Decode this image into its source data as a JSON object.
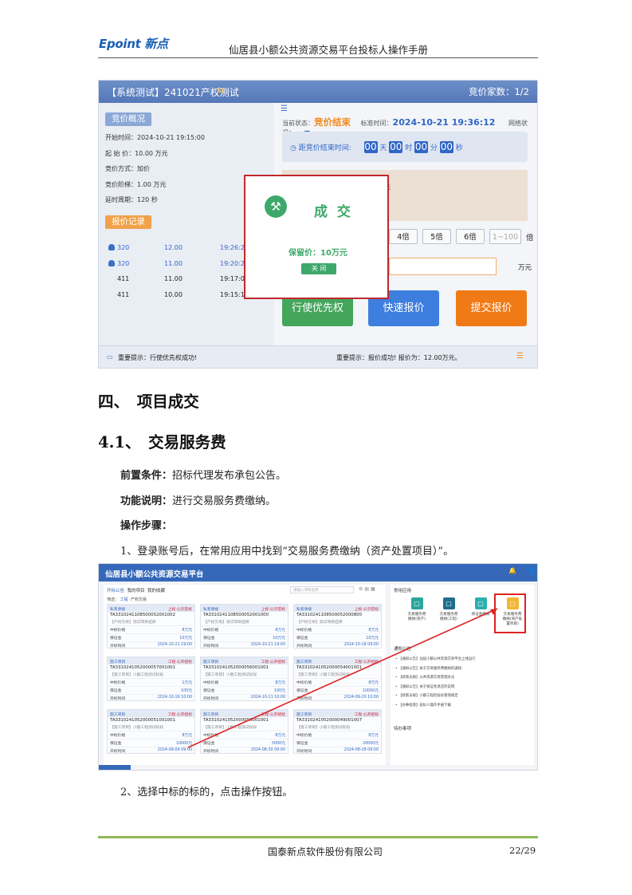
{
  "header": {
    "logo": "Epoint 新点",
    "doc_title": "仙居县小额公共资源交易平台投标人操作手册"
  },
  "shot1": {
    "title": "【系统测试】241021产权测试",
    "swap_icon": "⇆",
    "bidder_count_label": "竞价家数：1/2",
    "overview_tag": "竞价概况",
    "overview": [
      {
        "k": "开始时间：",
        "v": "2024-10-21 19:15:00"
      },
      {
        "k": "起 始 价：",
        "v": "10.00 万元"
      },
      {
        "k": "竞价方式：",
        "v": "加价"
      },
      {
        "k": "竞价阶梯：",
        "v": "1.00 万元"
      },
      {
        "k": "延时周期：",
        "v": "120 秒"
      }
    ],
    "records_tag": "报价记录",
    "records": [
      {
        "user": true,
        "id": "320",
        "price": "12.00",
        "time": "19:26:29"
      },
      {
        "user": true,
        "id": "320",
        "price": "11.00",
        "time": "19:20:22"
      },
      {
        "user": false,
        "id": "411",
        "price": "11.00",
        "time": "19:17:05"
      },
      {
        "user": false,
        "id": "411",
        "price": "10.00",
        "time": "19:15:13"
      }
    ],
    "status_label": "当前状态：",
    "status_value": "竞价结束",
    "std_time_label": "标准时间：",
    "std_time_value": "2024-10-21 19:36:12",
    "network_label": "网络状况：",
    "countdown_label": "距竞价结束时间:",
    "countdown": {
      "d": "00",
      "d_unit": "天",
      "h": "00",
      "h_unit": "时",
      "m": "00",
      "m_unit": "分",
      "s": "00",
      "s_unit": "秒"
    },
    "beige_fragment": "元",
    "multipliers": [
      "4倍",
      "5倍",
      "6倍",
      "1~100"
    ],
    "mult_unit": "倍",
    "amount_unit": "万元",
    "buttons": {
      "priority": "行使优先权",
      "quick": "快速报价",
      "submit": "提交报价"
    },
    "tip_left": "重要提示：行使优先权成功!",
    "tip_right": "重要提示：报价成功! 报价为：12.00万元。",
    "popup": {
      "title": "成 交",
      "reserve": "保留价：10万元",
      "close": "关 闭"
    }
  },
  "section_heading": "四、　项目成交",
  "subsection_heading": "4.1、　交易服务费",
  "paragraphs": {
    "pre_label": "前置条件：",
    "pre_text": "招标代理发布承包公告。",
    "func_label": "功能说明：",
    "func_text": "进行交易服务费缴纳。",
    "steps_label": "操作步骤：",
    "step1": "1、登录账号后，在常用应用中找到“交易服务费缴纳（资产处置项目）”。",
    "step2": "2、选择中标的标的，点击操作按钮。"
  },
  "shot2": {
    "title": "仙居县小额公共资源交易平台",
    "tabs": [
      "开标公告",
      "我的项目",
      "我的收藏"
    ],
    "search_placeholder": "请输入项目名称",
    "filter_label": "筛选：",
    "filter_values": [
      "工程",
      "产权交易"
    ],
    "apps_title": "常用应用",
    "apps": [
      {
        "label": "交易服务费缴纳(资产)",
        "color": "#2aa59a"
      },
      {
        "label": "交易服务费缴纳(工程)",
        "color": "#1f6e8c"
      },
      {
        "label": "保证金缴纳",
        "color": "#2bb0b0"
      },
      {
        "label": "交易服务费缴纳(资产处置项目)",
        "color": "#f2b632"
      }
    ],
    "notices_title": "通知公告",
    "notices": [
      "【通知公告】仙居小额公共资源交易平台上线运行",
      "【通知公告】关于交易服务费缴纳的通知",
      "【政策法规】公共资源交易管理办法",
      "【通知公告】关于保证金退还的说明",
      "【政策法规】小额工程招投标管理规定",
      "【办事指南】投标人操作手册下载"
    ],
    "todo_title": "待办事项",
    "cards": [
      {
        "cat": "私有承接",
        "stage": "上标·公示前标",
        "code": "TA3310241108500052001002",
        "desc": "【产权交易】测试项目挂牌",
        "rows": [
          [
            "中标价格",
            "8万元"
          ],
          [
            "保证金",
            "10万元"
          ],
          [
            "开标时间",
            "2024-10-21 19:00"
          ]
        ]
      },
      {
        "cat": "私有承接",
        "stage": "上标·公示前标",
        "code": "TA3310241108500052001000",
        "desc": "【产权交易】测试项目挂牌",
        "rows": [
          [
            "中标价格",
            "8万元"
          ],
          [
            "保证金",
            "10万元"
          ],
          [
            "开标时间",
            "2024-10-21 19:00"
          ]
        ]
      },
      {
        "cat": "私有承接",
        "stage": "上标·公示前标",
        "code": "TA3310241108500052000800",
        "desc": "【产权交易】测试项目挂牌",
        "rows": [
          [
            "中标价格",
            "8万元"
          ],
          [
            "保证金",
            "10万元"
          ],
          [
            "开标时间",
            "2024-10-18 09:00"
          ]
        ]
      },
      {
        "cat": "施工项目",
        "stage": "工程·公开招标",
        "code": "TA3310241052000057001001",
        "desc": "【施工项目】小额工程测试标段",
        "rows": [
          [
            "中标价格",
            "1万元"
          ],
          [
            "保证金",
            "100元"
          ],
          [
            "开标时间",
            "2024-10-16 10:00"
          ]
        ]
      },
      {
        "cat": "施工项目",
        "stage": "工程·公开招标",
        "code": "TA3310241052000056001001",
        "desc": "【施工项目】小额工程测试标段",
        "rows": [
          [
            "中标价格",
            "8万元"
          ],
          [
            "保证金",
            "100元"
          ],
          [
            "开标时间",
            "2024-10-11 10:00"
          ]
        ]
      },
      {
        "cat": "施工项目",
        "stage": "工程·公开招标",
        "code": "TA3310241052000054001001",
        "desc": "【施工项目】小额工程测试标段",
        "rows": [
          [
            "中标价格",
            "8万元"
          ],
          [
            "保证金",
            "10000元"
          ],
          [
            "开标时间",
            "2024-09-20 10:00"
          ]
        ]
      },
      {
        "cat": "施工项目",
        "stage": "工程·公开招标",
        "code": "TA3310241052000051001001",
        "desc": "【施工项目】小额工程测试标段",
        "rows": [
          [
            "中标价格",
            "8万元"
          ],
          [
            "保证金",
            "10000元"
          ],
          [
            "开标时间",
            "2024-09-04 09:00"
          ]
        ]
      },
      {
        "cat": "施工项目",
        "stage": "工程·公开招标",
        "code": "TA3310241052000050001001",
        "desc": "【施工项目】小额工程测试标段",
        "rows": [
          [
            "中标价格",
            "8万元"
          ],
          [
            "保证金",
            "5000元"
          ],
          [
            "开标时间",
            "2024-08-30 09:00"
          ]
        ]
      },
      {
        "cat": "施工项目",
        "stage": "工程·公开招标",
        "code": "TA3310241052000049001007",
        "desc": "【施工项目】小额工程测试标段",
        "rows": [
          [
            "中标价格",
            "8万元"
          ],
          [
            "保证金",
            "20000元"
          ],
          [
            "开标时间",
            "2024-08-28 09:00"
          ]
        ]
      }
    ]
  },
  "footer": {
    "company": "国泰新点软件股份有限公司",
    "page": "22/29"
  },
  "colors": {
    "accent_blue": "#2f66c8",
    "deal_green": "#3ea86a",
    "highlight_red": "#c0282d",
    "footer_green": "#8fb85a"
  }
}
